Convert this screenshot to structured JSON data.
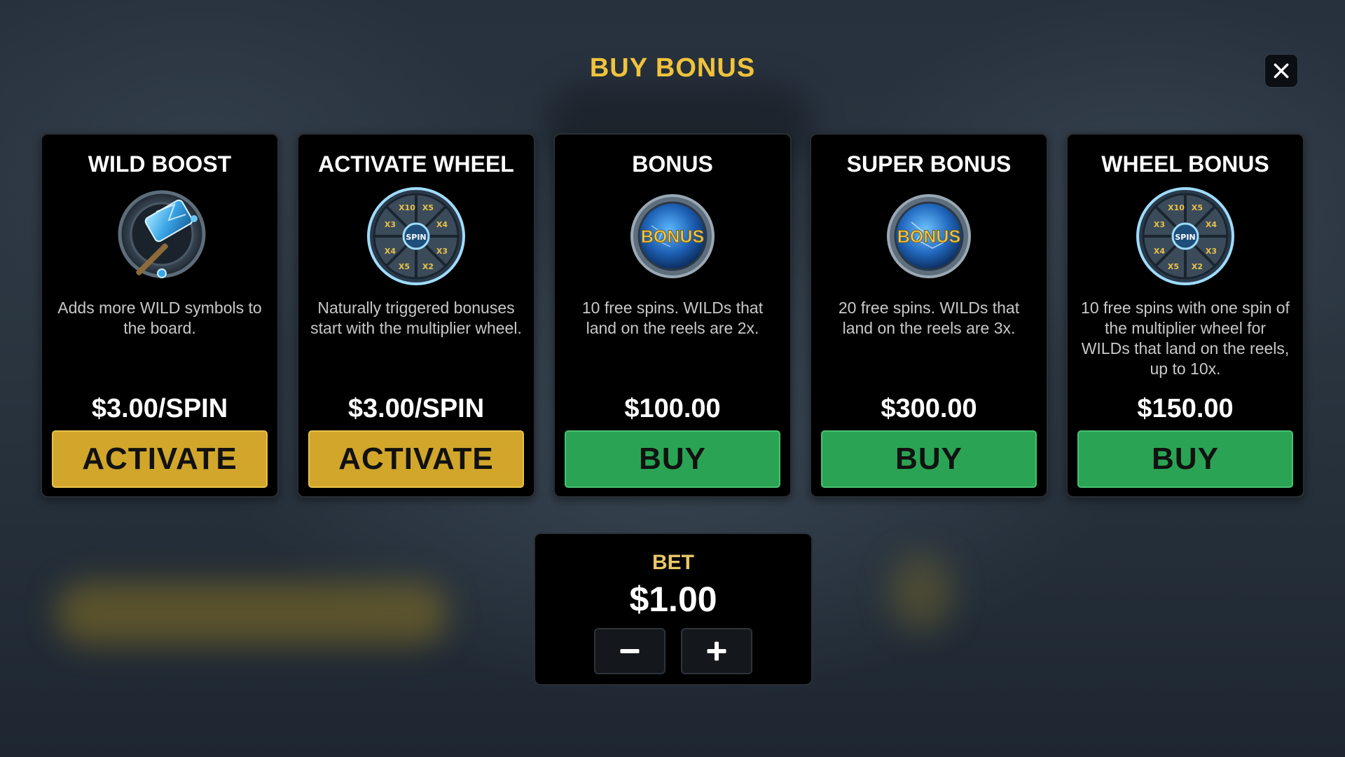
{
  "header": {
    "title": "BUY BONUS",
    "close_icon": "close-icon"
  },
  "cards": [
    {
      "title": "WILD BOOST",
      "icon": "hammer-icon",
      "description": "Adds more WILD symbols to the board.",
      "price": "$3.00/SPIN",
      "button_label": "ACTIVATE",
      "button_color": "#d1a62a"
    },
    {
      "title": "ACTIVATE WHEEL",
      "icon": "multiplier-wheel-icon",
      "wheel_center_text": "SPIN",
      "description": "Naturally triggered bonuses start with the multiplier wheel.",
      "price": "$3.00/SPIN",
      "button_label": "ACTIVATE",
      "button_color": "#d1a62a"
    },
    {
      "title": "BONUS",
      "icon": "bonus-orb-icon",
      "orb_text": "BONUS",
      "description": "10 free spins. WILDs that land on the reels are 2x.",
      "price": "$100.00",
      "button_label": "BUY",
      "button_color": "#2aa454"
    },
    {
      "title": "SUPER BONUS",
      "icon": "super-bonus-orb-icon",
      "orb_text": "BONUS",
      "description": "20 free spins. WILDs that land on the reels are 3x.",
      "price": "$300.00",
      "button_label": "BUY",
      "button_color": "#2aa454"
    },
    {
      "title": "WHEEL BONUS",
      "icon": "multiplier-wheel-icon",
      "wheel_center_text": "SPIN",
      "description": "10 free spins with one spin of the multiplier wheel for WILDs that land on the reels, up to 10x.",
      "price": "$150.00",
      "button_label": "BUY",
      "button_color": "#2aa454"
    }
  ],
  "bet": {
    "label": "BET",
    "value": "$1.00",
    "decrease_icon": "minus-icon",
    "increase_icon": "plus-icon"
  },
  "colors": {
    "title_gold": "#f0c33c",
    "bet_label_gold": "#e8c76a",
    "gold_button": "#d1a62a",
    "green_button": "#2aa454",
    "panel_bg": "#000000"
  }
}
